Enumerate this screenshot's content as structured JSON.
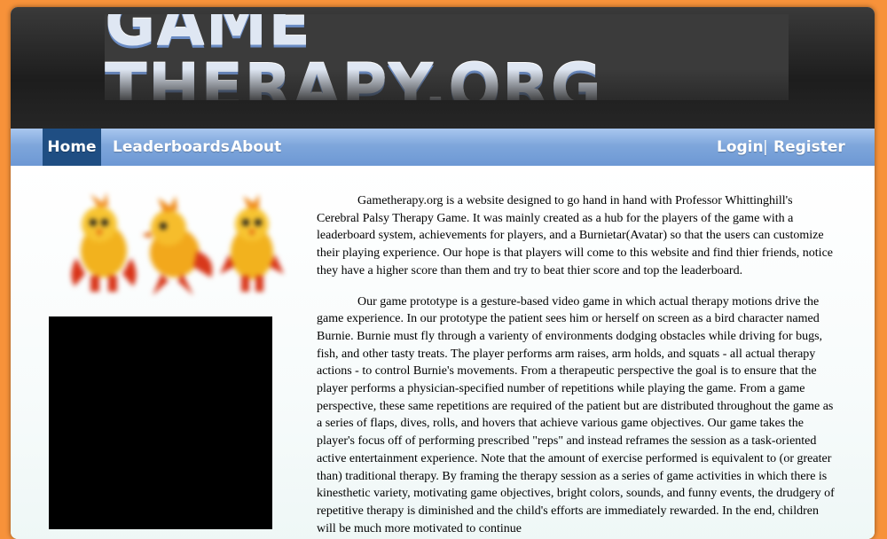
{
  "site": {
    "logo_text": "GAME THERAPY.ORG"
  },
  "nav": {
    "home": "Home",
    "leaderboards": "Leaderboards",
    "about": "About",
    "login": "Login",
    "separator": "|",
    "register": "Register"
  },
  "main": {
    "paragraph1": "Gametherapy.org is a website designed to go hand in hand with Professor Whittinghill's Cerebral Palsy Therapy Game. It was mainly created as a hub for the players of the game with a leaderboard system, achievements for players, and a Burnietar(Avatar) so that the users can customize their playing experience. Our hope is that players will come to this website and find thier friends, notice they have a higher score than them and try to beat thier score and top the leaderboard.",
    "paragraph2": "Our game prototype is a gesture-based video game in which actual therapy motions drive the game experience. In our prototype the patient sees him or herself on screen as a bird character named Burnie. Burnie must fly through a varienty of environments dodging obstacles while driving for bugs, fish, and other tasty treats. The player performs arm raises, arm holds, and squats - all actual therapy actions - to control Burnie's movements. From a therapeutic perspective the goal is to ensure that the player performs a physician-specified number of repetitions while playing the game. From a game perspective, these same repetitions are required of the patient but are distributed throughout the game as a series of flaps, dives, rolls, and hovers that achieve various game objectives. Our game takes the player's focus off of performing prescribed \"reps\" and instead reframes the session as a task-oriented active entertainment experience. Note that the amount of exercise performed is equivalent to (or greater than) traditional therapy. By framing the therapy session as a series of game activities in which there is kinesthetic variety, motivating game objectives, bright colors, sounds, and funny events, the drudgery of repetitive therapy is diminished and the child's efforts are immediately rewarded. In the end, children will be much more motivated to continue"
  },
  "colors": {
    "page_bg": "#f7923a",
    "nav_active": "#1f4e83",
    "nav_bar": "#7ea6db",
    "header_dark": "#1d1d1d"
  },
  "icons": {
    "mascot": "burnie-bird-icon"
  }
}
